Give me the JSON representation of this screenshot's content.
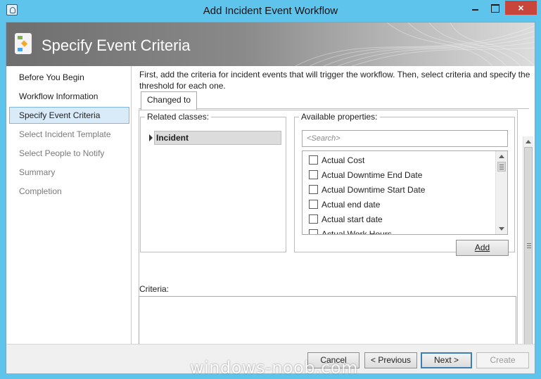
{
  "window": {
    "title": "Add Incident Event Workflow",
    "close_glyph": "×"
  },
  "banner": {
    "title": "Specify Event Criteria"
  },
  "nav": {
    "items": [
      {
        "label": "Before You Begin",
        "state": "normal"
      },
      {
        "label": "Workflow Information",
        "state": "normal"
      },
      {
        "label": "Specify Event Criteria",
        "state": "selected"
      },
      {
        "label": "Select Incident Template",
        "state": "disabled"
      },
      {
        "label": "Select People to Notify",
        "state": "disabled"
      },
      {
        "label": "Summary",
        "state": "disabled"
      },
      {
        "label": "Completion",
        "state": "disabled"
      }
    ]
  },
  "main": {
    "intro": "First, add the criteria for incident events that will trigger the workflow. Then, select criteria and specify the threshold for each one.",
    "tabs": [
      {
        "label": "Changed to"
      }
    ],
    "related_classes": {
      "label": "Related classes:",
      "items": [
        {
          "label": "Incident"
        }
      ]
    },
    "available_properties": {
      "label": "Available properties:",
      "search_placeholder": "<Search>",
      "items": [
        {
          "label": "Actual Cost",
          "checked": false
        },
        {
          "label": "Actual Downtime End Date",
          "checked": false
        },
        {
          "label": "Actual Downtime Start Date",
          "checked": false
        },
        {
          "label": "Actual end date",
          "checked": false
        },
        {
          "label": "Actual start date",
          "checked": false
        },
        {
          "label": "Actual Work Hours",
          "checked": false
        }
      ],
      "add_button": "Add"
    },
    "criteria_label": "Criteria:"
  },
  "footer": {
    "cancel": "Cancel",
    "previous": "< Previous",
    "next": "Next >",
    "create": "Create"
  },
  "watermark": "windows-noob.com",
  "colors": {
    "frame": "#5fc4ec",
    "close_button": "#c7453a",
    "nav_selected": "#d9ebf8"
  }
}
